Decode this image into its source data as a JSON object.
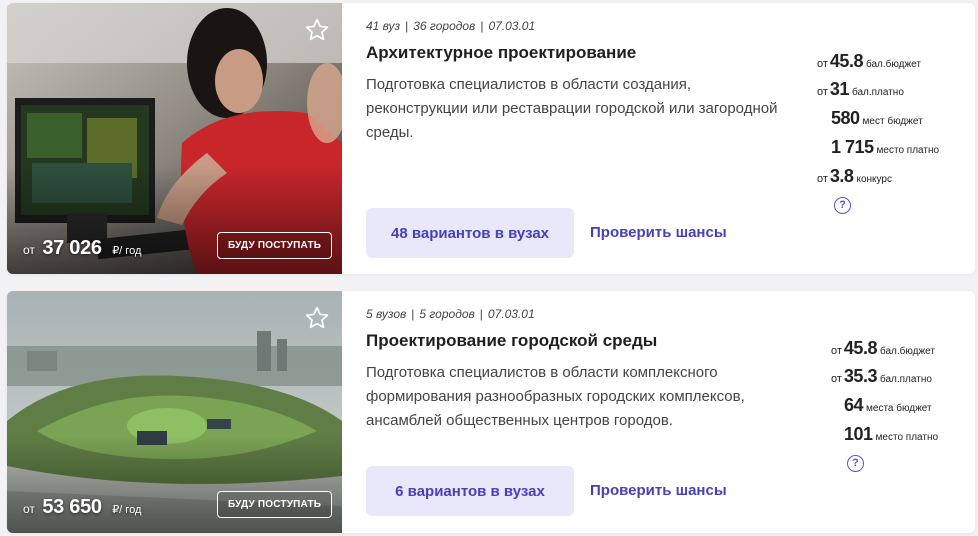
{
  "cards": [
    {
      "meta": {
        "universities": "41 вуз",
        "cities": "36 городов",
        "code": "07.03.01"
      },
      "title": "Архитектурное проектирование",
      "description": "Подготовка специалистов в области создания, реконструкции или реставрации городской или загородной среды.",
      "price": {
        "prefix": "от",
        "value": "37 026",
        "unit": "₽/ год"
      },
      "enroll_label": "БУДУ ПОСТУПАТЬ",
      "variants_label": "48 вариантов в вузах",
      "check_label": "Проверить шансы",
      "stats": {
        "budget_score": {
          "prefix": "от",
          "value": "45.8",
          "label": "бал.бюджет"
        },
        "paid_score": {
          "prefix": "от",
          "value": "31",
          "label": "бал.платно"
        },
        "budget_places": {
          "value": "580",
          "label": "мест бюджет"
        },
        "paid_places": {
          "value": "1 715",
          "label": "место платно"
        },
        "competition": {
          "prefix": "от",
          "value": "3.8",
          "label": "конкурс"
        }
      },
      "help_icon": "?"
    },
    {
      "meta": {
        "universities": "5 вузов",
        "cities": "5 городов",
        "code": "07.03.01"
      },
      "title": "Проектирование городской среды",
      "description": "Подготовка специалистов в области комплексного формирования разнообразных городских комплексов, ансамблей общественных центров городов.",
      "price": {
        "prefix": "от",
        "value": "53 650",
        "unit": "₽/ год"
      },
      "enroll_label": "БУДУ ПОСТУПАТЬ",
      "variants_label": "6 вариантов в вузах",
      "check_label": "Проверить шансы",
      "stats": {
        "budget_score": {
          "prefix": "от",
          "value": "45.8",
          "label": "бал.бюджет"
        },
        "paid_score": {
          "prefix": "от",
          "value": "35.3",
          "label": "бал.платно"
        },
        "budget_places": {
          "value": "64",
          "label": "места бюджет"
        },
        "paid_places": {
          "value": "101",
          "label": "место платно"
        }
      },
      "help_icon": "?"
    }
  ],
  "colors": {
    "accent": "#4740b6",
    "button_bg": "#e9e8fb",
    "page_bg": "#f2f2f4"
  },
  "icons": {
    "favorite": "star-outline-icon",
    "help": "question-circle-icon"
  }
}
